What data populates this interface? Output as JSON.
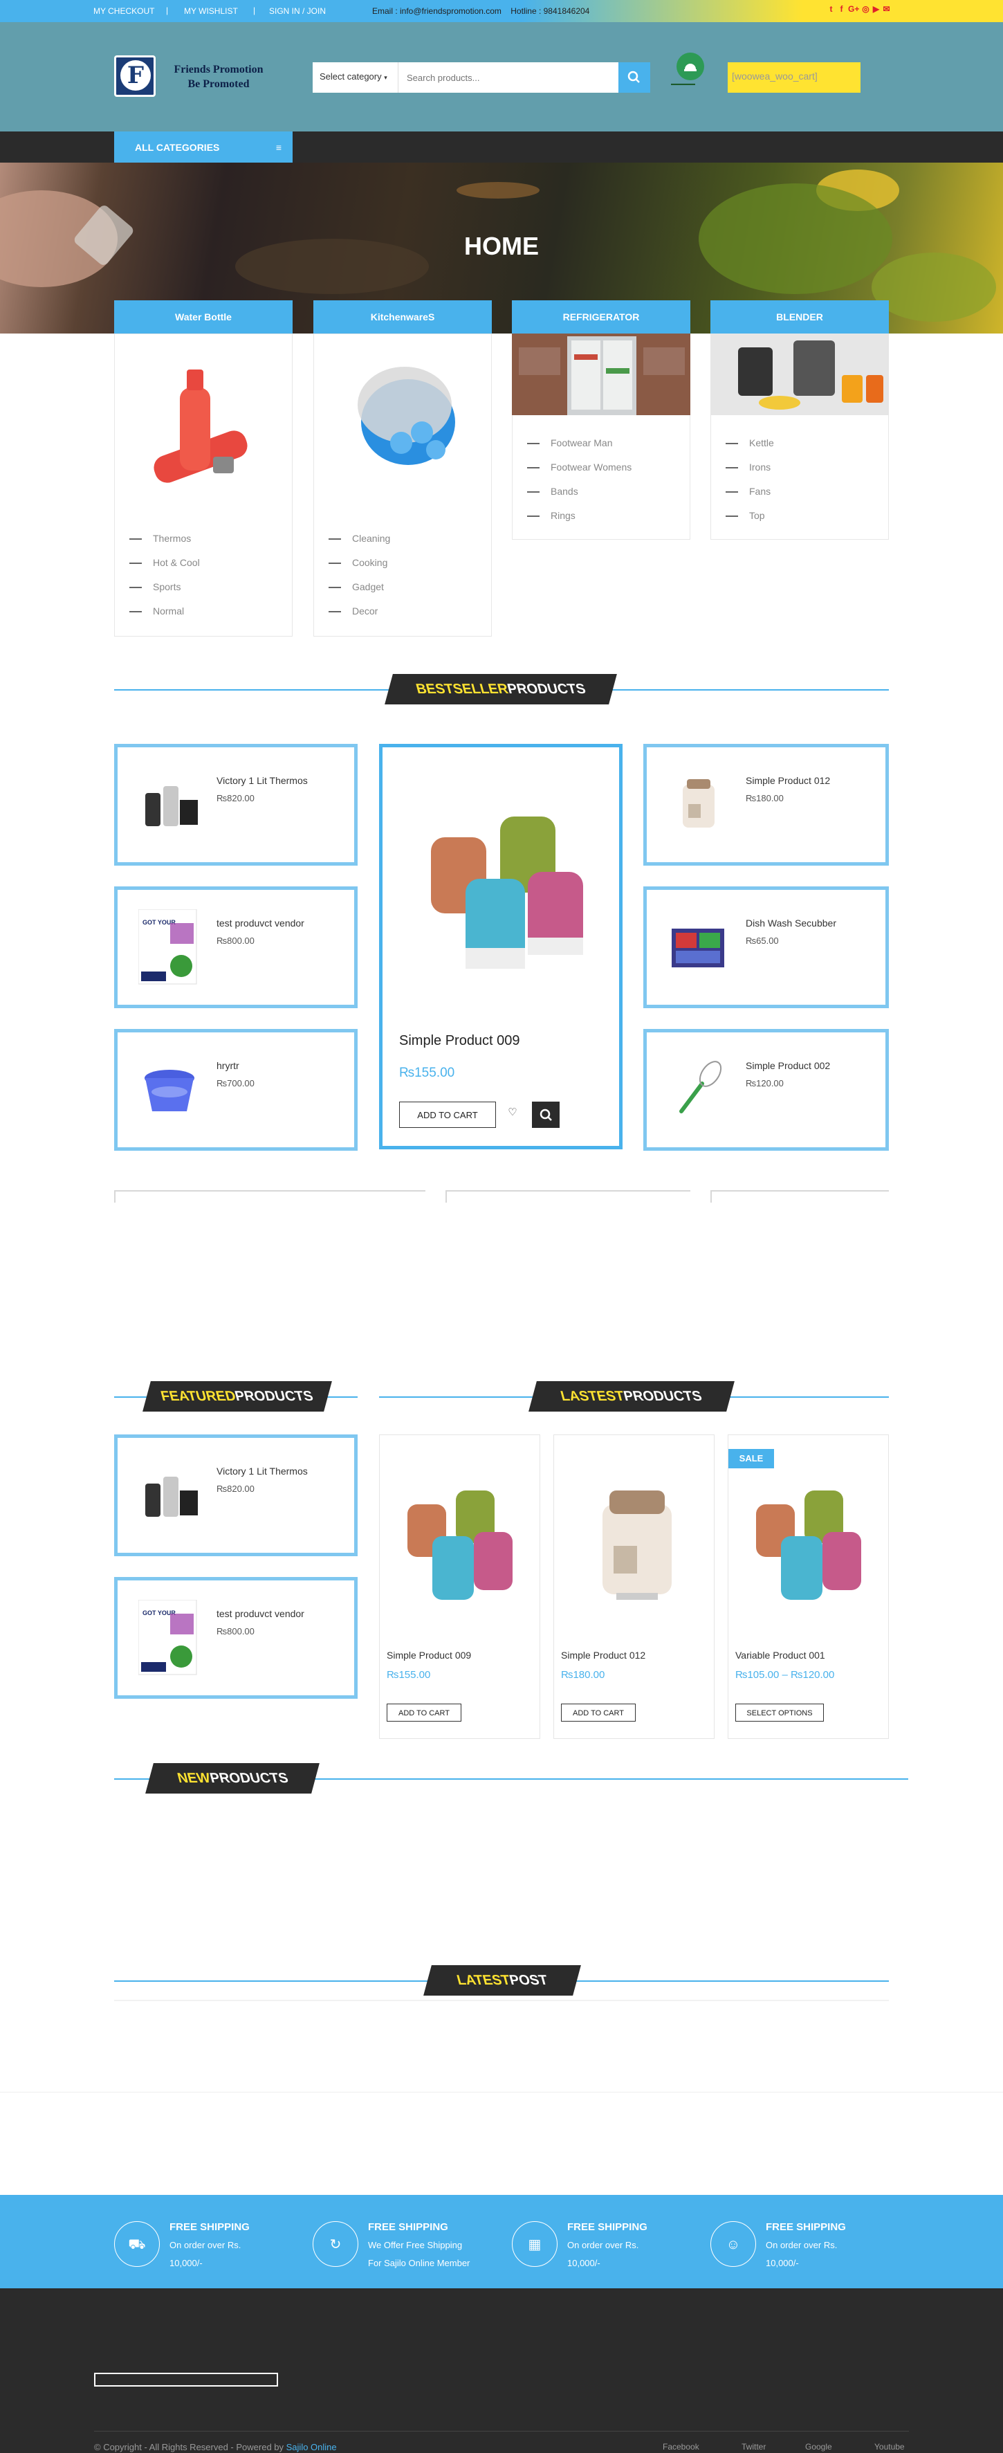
{
  "topbar": {
    "links": [
      "MY CHECKOUT",
      "MY WISHLIST",
      "SIGN IN / JOIN"
    ],
    "email_label": "Email : info@friendspromotion.com",
    "hotline_label": "Hotline : 9841846204",
    "social_icons": [
      "twitter-icon",
      "facebook-icon",
      "google-plus-icon",
      "instagram-icon",
      "youtube-icon",
      "mail-icon"
    ]
  },
  "header": {
    "logo_letter": "F",
    "logo_text_line1": "Friends Promotion",
    "logo_text_line2": "Be Promoted",
    "search_category": "Select category",
    "search_placeholder": "Search products...",
    "cart_text": "[woowea_woo_cart]"
  },
  "nav": {
    "all_categories": "ALL CATEGORIES"
  },
  "hero": {
    "title": "HOME"
  },
  "categories": [
    {
      "title": "Water Bottle",
      "items": [
        "Thermos",
        "Hot & Cool",
        "Sports",
        "Normal"
      ]
    },
    {
      "title": "KitchenwareS",
      "items": [
        "Cleaning",
        "Cooking",
        "Gadget",
        "Decor"
      ]
    },
    {
      "title": "REFRIGERATOR",
      "items": [
        "Footwear Man",
        "Footwear Womens",
        "Bands",
        "Rings"
      ]
    },
    {
      "title": "BLENDER",
      "items": [
        "Kettle",
        "Irons",
        "Fans",
        "Top"
      ]
    }
  ],
  "bestseller": {
    "title_highlight": "BESTSELLER",
    "title_rest": " PRODUCTS",
    "left": [
      {
        "name": "Victory 1 Lit Thermos",
        "price": "₨820.00"
      },
      {
        "name": "test produvct vendor",
        "price": "₨800.00"
      },
      {
        "name": "hryrtr",
        "price": "₨700.00"
      }
    ],
    "right": [
      {
        "name": "Simple Product 012",
        "price": "₨180.00"
      },
      {
        "name": "Dish Wash Secubber",
        "price": "₨65.00"
      },
      {
        "name": "Simple Product 002",
        "price": "₨120.00"
      }
    ],
    "featured": {
      "name": "Simple Product 009",
      "price": "₨155.00",
      "button": "ADD TO CART"
    }
  },
  "featured": {
    "title_highlight": "FEATURED",
    "title_rest": " PRODUCTS",
    "items": [
      {
        "name": "Victory 1 Lit Thermos",
        "price": "₨820.00"
      },
      {
        "name": "test produvct vendor",
        "price": "₨800.00"
      }
    ]
  },
  "lastest": {
    "title_highlight": "LASTEST",
    "title_rest": " PRODUCTS",
    "items": [
      {
        "name": "Simple Product 009",
        "price": "₨155.00",
        "button": "ADD TO CART"
      },
      {
        "name": "Simple Product 012",
        "price": "₨180.00",
        "button": "ADD TO CART"
      },
      {
        "name": "Variable Product 001",
        "price": "₨105.00 – ₨120.00",
        "button": "SELECT OPTIONS",
        "badge": "SALE"
      }
    ]
  },
  "new_products": {
    "title_highlight": "NEW",
    "title_rest": " PRODUCTS"
  },
  "latest_post": {
    "title_highlight": "LATEST",
    "title_rest": " POST"
  },
  "features": [
    {
      "title": "FREE SHIPPING",
      "desc": "On order over Rs. 10,000/-",
      "icon": "truck-icon"
    },
    {
      "title": "FREE SHIPPING",
      "desc": "We Offer Free Shipping For Sajilo Online Member",
      "icon": "refresh-icon"
    },
    {
      "title": "FREE SHIPPING",
      "desc": "On order over Rs. 10,000/-",
      "icon": "calendar-icon"
    },
    {
      "title": "FREE SHIPPING",
      "desc": "On order over Rs. 10,000/-",
      "icon": "users-icon"
    }
  ],
  "footer": {
    "copyright": "© Copyright - All Rights Reserved - Powered by ",
    "powered_by": "Sajilo Online",
    "links": [
      "Facebook",
      "Twitter",
      "Google",
      "Youtube"
    ]
  },
  "colors": {
    "accent": "#49b2ec",
    "yellow": "#ffe331",
    "dark": "#2b2b2b",
    "header_bg": "#629eac"
  }
}
